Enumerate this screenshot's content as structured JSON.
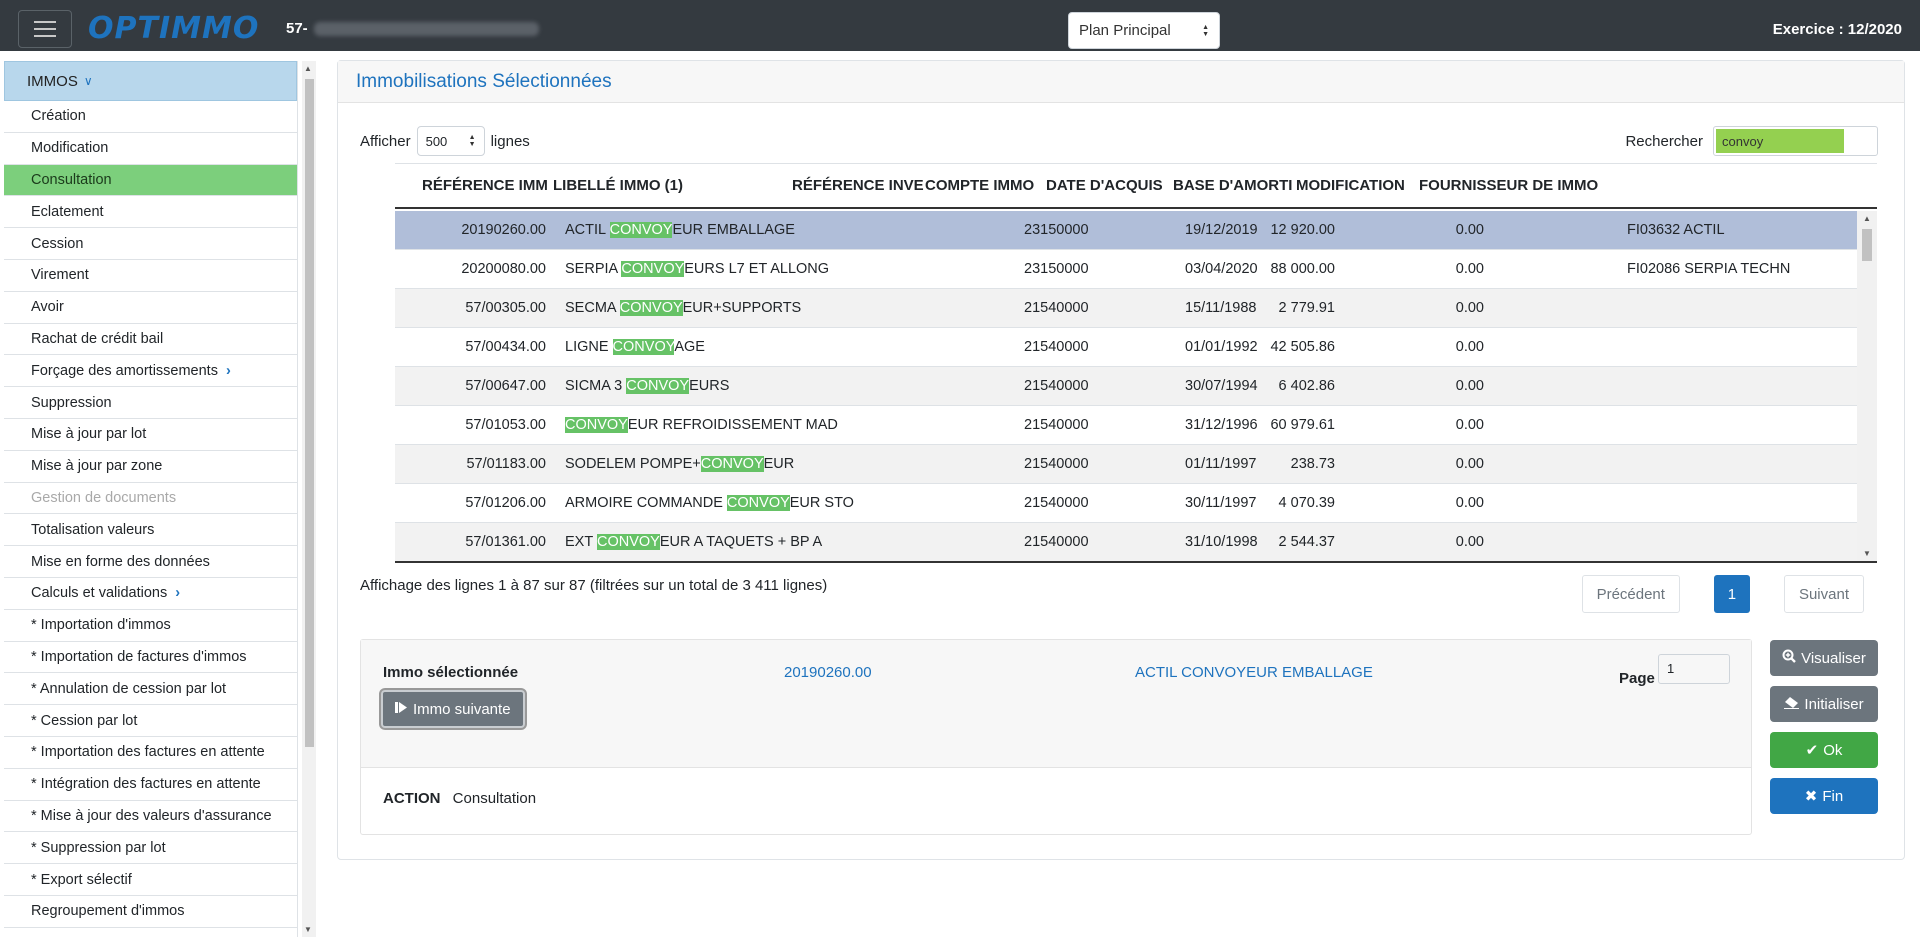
{
  "header": {
    "company_prefix": "57-",
    "plan_select": "Plan Principal",
    "exercice": "Exercice : 12/2020",
    "logo": "OPTIMMO"
  },
  "sidebar": {
    "section": "IMMOS",
    "items": [
      {
        "label": "Création"
      },
      {
        "label": "Modification"
      },
      {
        "label": "Consultation",
        "active": true
      },
      {
        "label": "Eclatement"
      },
      {
        "label": "Cession"
      },
      {
        "label": "Virement"
      },
      {
        "label": "Avoir"
      },
      {
        "label": "Rachat de crédit bail"
      },
      {
        "label": "Forçage des amortissements",
        "submenu": true
      },
      {
        "label": "Suppression"
      },
      {
        "label": "Mise à jour par lot"
      },
      {
        "label": "Mise à jour par zone"
      },
      {
        "label": "Gestion de documents",
        "disabled": true
      },
      {
        "label": "Totalisation valeurs"
      },
      {
        "label": "Mise en forme des données"
      },
      {
        "label": "Calculs et validations",
        "submenu": true
      },
      {
        "label": "* Importation d'immos"
      },
      {
        "label": "* Importation de factures d'immos"
      },
      {
        "label": "* Annulation de cession par lot"
      },
      {
        "label": "* Cession par lot"
      },
      {
        "label": "* Importation des factures en attente"
      },
      {
        "label": "* Intégration des factures en attente"
      },
      {
        "label": "* Mise à jour des valeurs d'assurance"
      },
      {
        "label": "* Suppression par lot"
      },
      {
        "label": "* Export sélectif"
      },
      {
        "label": "Regroupement d'immos"
      }
    ]
  },
  "main": {
    "title": "Immobilisations Sélectionnées",
    "show_label": "Afficher",
    "show_value": "500",
    "lines_label": "lignes",
    "search_label": "Rechercher",
    "search_value": "convoy",
    "columns": [
      "RÉFÉRENCE IMM",
      "LIBELLÉ IMMO (1)",
      "RÉFÉRENCE INVE",
      "COMPTE IMMO",
      "DATE D'ACQUIS",
      "BASE D'AMORTI",
      "MODIFICATION",
      "FOURNISSEUR DE IMMO"
    ],
    "rows": [
      {
        "ref": "20190260.00",
        "lib_pre": "ACTIL ",
        "lib_hl": "CONVOY",
        "lib_post": "EUR EMBALLAGE",
        "inv": "",
        "compte": "23150000",
        "date": "19/12/2019",
        "base": "12 920.00",
        "modif": "0.00",
        "four": "FI03632 ACTIL"
      },
      {
        "ref": "20200080.00",
        "lib_pre": "SERPIA ",
        "lib_hl": "CONVOY",
        "lib_post": "EURS L7 ET ALLONG",
        "inv": "",
        "compte": "23150000",
        "date": "03/04/2020",
        "base": "88 000.00",
        "modif": "0.00",
        "four": "FI02086 SERPIA TECHN"
      },
      {
        "ref": "57/00305.00",
        "lib_pre": "SECMA ",
        "lib_hl": "CONVOY",
        "lib_post": "EUR+SUPPORTS",
        "inv": "",
        "compte": "21540000",
        "date": "15/11/1988",
        "base": "2 779.91",
        "modif": "0.00",
        "four": ""
      },
      {
        "ref": "57/00434.00",
        "lib_pre": "LIGNE ",
        "lib_hl": "CONVOY",
        "lib_post": "AGE",
        "inv": "",
        "compte": "21540000",
        "date": "01/01/1992",
        "base": "42 505.86",
        "modif": "0.00",
        "four": ""
      },
      {
        "ref": "57/00647.00",
        "lib_pre": "SICMA 3 ",
        "lib_hl": "CONVOY",
        "lib_post": "EURS",
        "inv": "",
        "compte": "21540000",
        "date": "30/07/1994",
        "base": "6 402.86",
        "modif": "0.00",
        "four": ""
      },
      {
        "ref": "57/01053.00",
        "lib_pre": "",
        "lib_hl": "CONVOY",
        "lib_post": "EUR REFROIDISSEMENT MAD",
        "inv": "",
        "compte": "21540000",
        "date": "31/12/1996",
        "base": "60 979.61",
        "modif": "0.00",
        "four": ""
      },
      {
        "ref": "57/01183.00",
        "lib_pre": "SODELEM POMPE+",
        "lib_hl": "CONVOY",
        "lib_post": "EUR",
        "inv": "",
        "compte": "21540000",
        "date": "01/11/1997",
        "base": "238.73",
        "modif": "0.00",
        "four": ""
      },
      {
        "ref": "57/01206.00",
        "lib_pre": "ARMOIRE COMMANDE ",
        "lib_hl": "CONVOY",
        "lib_post": "EUR STO",
        "inv": "",
        "compte": "21540000",
        "date": "30/11/1997",
        "base": "4 070.39",
        "modif": "0.00",
        "four": ""
      },
      {
        "ref": "57/01361.00",
        "lib_pre": "EXT ",
        "lib_hl": "CONVOY",
        "lib_post": "EUR A TAQUETS + BP A",
        "inv": "",
        "compte": "21540000",
        "date": "31/10/1998",
        "base": "2 544.37",
        "modif": "0.00",
        "four": ""
      }
    ],
    "info": "Affichage des lignes 1 à 87 sur 87 (filtrées sur un total de 3 411 lignes)",
    "prev": "Précédent",
    "page": "1",
    "next": "Suivant"
  },
  "selection": {
    "label": "Immo sélectionnée",
    "ref": "20190260.00",
    "libelle": "ACTIL CONVOYEUR EMBALLAGE",
    "page_label": "Page",
    "page_value": "1",
    "next_btn": "Immo suivante",
    "action_label": "ACTION",
    "action_value": "Consultation"
  },
  "buttons": {
    "visualiser": "Visualiser",
    "initialiser": "Initialiser",
    "ok": "Ok",
    "fin": "Fin"
  }
}
